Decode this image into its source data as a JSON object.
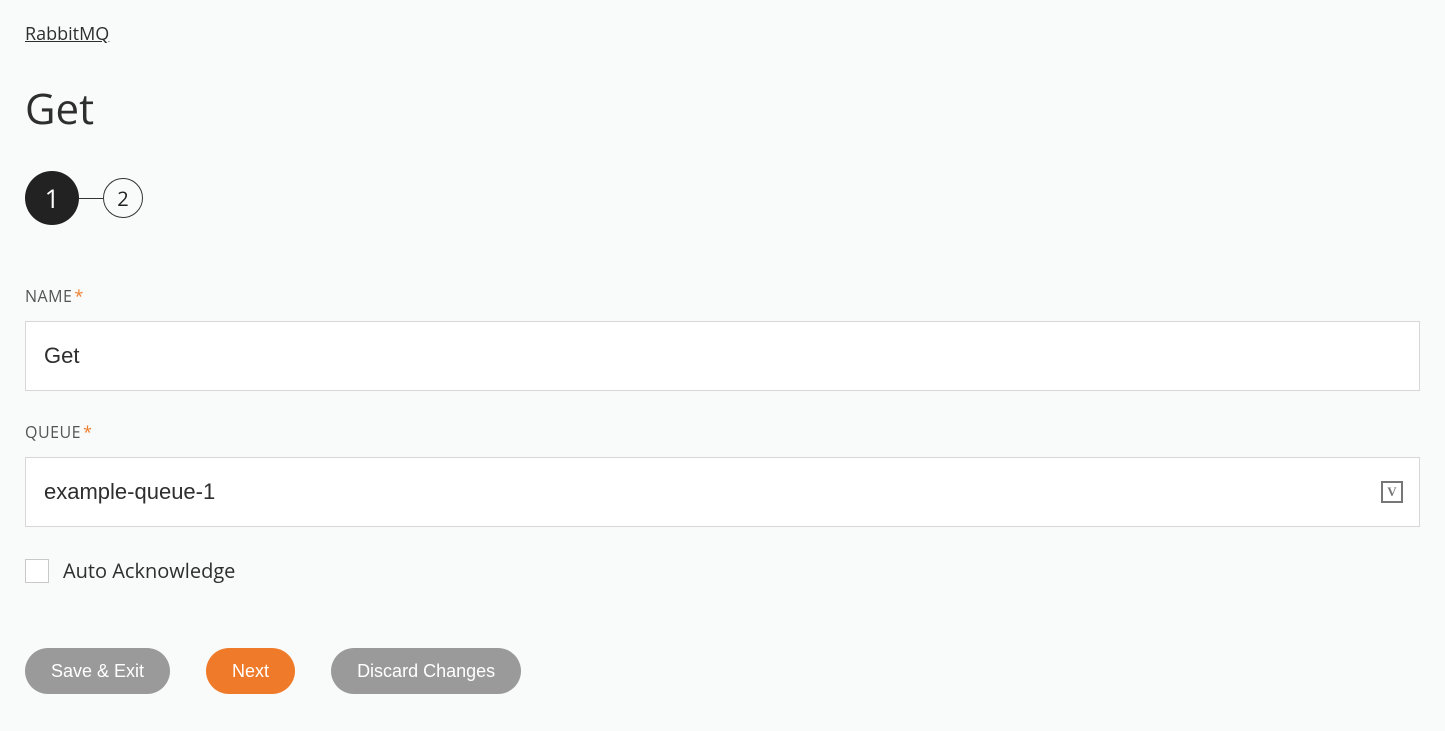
{
  "breadcrumb": "RabbitMQ",
  "title": "Get",
  "stepper": {
    "steps": [
      "1",
      "2"
    ],
    "activeIndex": 0
  },
  "fields": {
    "name": {
      "label": "NAME",
      "required": "*",
      "value": "Get"
    },
    "queue": {
      "label": "QUEUE",
      "required": "*",
      "value": "example-queue-1"
    }
  },
  "checkbox": {
    "label": "Auto Acknowledge",
    "checked": false
  },
  "buttons": {
    "save": "Save & Exit",
    "next": "Next",
    "discard": "Discard Changes"
  },
  "icons": {
    "variable": "V"
  }
}
